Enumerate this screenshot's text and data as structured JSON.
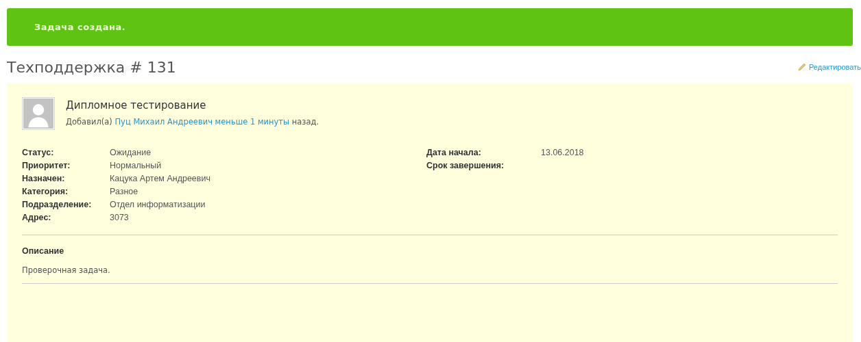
{
  "flash": {
    "text": "Задача создана."
  },
  "title": "Техподдержка # 131",
  "edit_link": "Редактировать",
  "issue": {
    "subject": "Дипломное тестирование",
    "added": {
      "prefix": "Добавил(а)",
      "author": "Пуц Михаил Андреевич",
      "time": "меньше 1 минуты",
      "suffix": "назад."
    },
    "attributes_left": [
      {
        "label": "Статус:",
        "value": "Ожидание"
      },
      {
        "label": "Приоритет:",
        "value": "Нормальный"
      },
      {
        "label": "Назначен:",
        "value": "Кацука Артем Андреевич"
      },
      {
        "label": "Категория:",
        "value": "Разное"
      },
      {
        "label": "Подразделение:",
        "value": "Отдел информатизации"
      },
      {
        "label": "Адрес:",
        "value": "3073"
      }
    ],
    "attributes_right": [
      {
        "label": "Дата начала:",
        "value": "13.06.2018"
      },
      {
        "label": "Срок завершения:"
      }
    ],
    "description_heading": "Описание",
    "description": "Проверочная задача."
  }
}
